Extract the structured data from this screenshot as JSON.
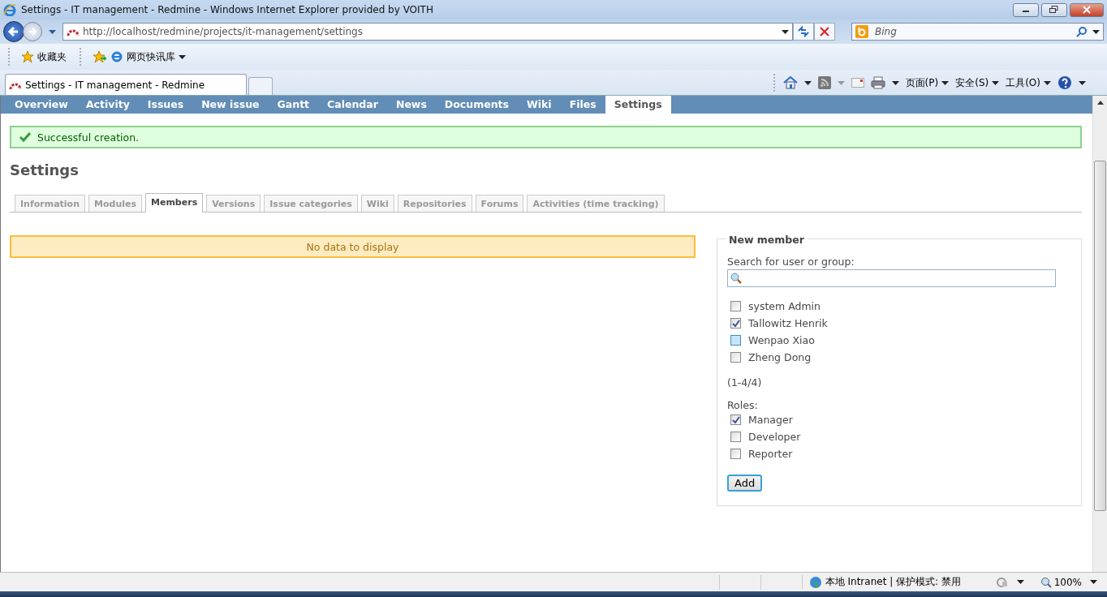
{
  "window": {
    "title": "Settings - IT management - Redmine - Windows Internet Explorer provided by VOITH"
  },
  "address_bar": {
    "url": "http://localhost/redmine/projects/it-management/settings"
  },
  "search_box": {
    "placeholder": "Bing"
  },
  "favorites_bar": [
    {
      "label": "收藏夹",
      "kind": "favorites"
    },
    {
      "label": "网页快讯库",
      "kind": "gallery"
    }
  ],
  "browser_tabs": [
    {
      "label": "Settings - IT management - Redmine",
      "selected": true
    }
  ],
  "command_bar": [
    "页面(P)",
    "安全(S)",
    "工具(O)"
  ],
  "main_menu": [
    {
      "label": "Overview",
      "selected": false
    },
    {
      "label": "Activity",
      "selected": false
    },
    {
      "label": "Issues",
      "selected": false
    },
    {
      "label": "New issue",
      "selected": false
    },
    {
      "label": "Gantt",
      "selected": false
    },
    {
      "label": "Calendar",
      "selected": false
    },
    {
      "label": "News",
      "selected": false
    },
    {
      "label": "Documents",
      "selected": false
    },
    {
      "label": "Wiki",
      "selected": false
    },
    {
      "label": "Files",
      "selected": false
    },
    {
      "label": "Settings",
      "selected": true
    }
  ],
  "flash_notice": "Successful creation.",
  "heading": "Settings",
  "settings_tabs": [
    {
      "label": "Information",
      "selected": false
    },
    {
      "label": "Modules",
      "selected": false
    },
    {
      "label": "Members",
      "selected": true
    },
    {
      "label": "Versions",
      "selected": false
    },
    {
      "label": "Issue categories",
      "selected": false
    },
    {
      "label": "Wiki",
      "selected": false
    },
    {
      "label": "Repositories",
      "selected": false
    },
    {
      "label": "Forums",
      "selected": false
    },
    {
      "label": "Activities (time tracking)",
      "selected": false
    }
  ],
  "members_notice": "No data to display",
  "new_member": {
    "legend": "New member",
    "search_label": "Search for user or group:",
    "users": [
      {
        "name": "system Admin",
        "checked": false,
        "hovered": false
      },
      {
        "name": "Tallowitz Henrik",
        "checked": true,
        "hovered": false
      },
      {
        "name": "Wenpao Xiao",
        "checked": false,
        "hovered": true
      },
      {
        "name": "Zheng Dong",
        "checked": false,
        "hovered": false
      }
    ],
    "pagination": "(1-4/4)",
    "roles_label": "Roles:",
    "roles": [
      {
        "name": "Manager",
        "checked": true
      },
      {
        "name": "Developer",
        "checked": false
      },
      {
        "name": "Reporter",
        "checked": false
      }
    ],
    "add_button": "Add"
  },
  "status_bar": {
    "zone": "本地 Intranet | 保护模式: 禁用",
    "zoom": "100%"
  }
}
